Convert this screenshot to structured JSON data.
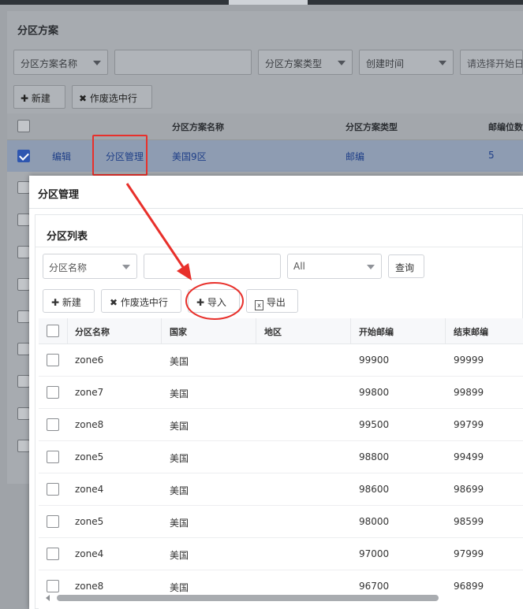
{
  "bg": {
    "title": "分区方案",
    "filters": {
      "field_select": "分区方案名称",
      "type_select": "分区方案类型",
      "time_select": "创建时间",
      "date_placeholder": "请选择开始日..."
    },
    "buttons": {
      "new": "新建",
      "disable": "作废选中行"
    },
    "columns": {
      "name": "分区方案名称",
      "type": "分区方案类型",
      "digits": "邮编位数"
    },
    "selected_row": {
      "edit": "编辑",
      "manage": "分区管理",
      "name": "美国9区",
      "type": "邮编",
      "digits": "5"
    }
  },
  "dialog": {
    "title": "分区管理",
    "section_title": "分区列表",
    "search": {
      "field_select": "分区名称",
      "input_value": "",
      "country_select": "All",
      "query_button": "查询"
    },
    "buttons": {
      "new": "新建",
      "disable": "作废选中行",
      "import": "导入",
      "export": "导出"
    },
    "columns": {
      "name": "分区名称",
      "country": "国家",
      "region": "地区",
      "start": "开始邮编",
      "end": "结束邮编"
    },
    "rows": [
      {
        "name": "zone6",
        "country": "美国",
        "region": "",
        "start": "99900",
        "end": "99999"
      },
      {
        "name": "zone7",
        "country": "美国",
        "region": "",
        "start": "99800",
        "end": "99899"
      },
      {
        "name": "zone8",
        "country": "美国",
        "region": "",
        "start": "99500",
        "end": "99799"
      },
      {
        "name": "zone5",
        "country": "美国",
        "region": "",
        "start": "98800",
        "end": "99499"
      },
      {
        "name": "zone4",
        "country": "美国",
        "region": "",
        "start": "98600",
        "end": "98699"
      },
      {
        "name": "zone5",
        "country": "美国",
        "region": "",
        "start": "98000",
        "end": "98599"
      },
      {
        "name": "zone4",
        "country": "美国",
        "region": "",
        "start": "97000",
        "end": "97999"
      },
      {
        "name": "zone8",
        "country": "美国",
        "region": "",
        "start": "96700",
        "end": "96899"
      }
    ]
  },
  "annotation": {
    "color": "#e8302b",
    "icon": "arrow-annotation"
  }
}
